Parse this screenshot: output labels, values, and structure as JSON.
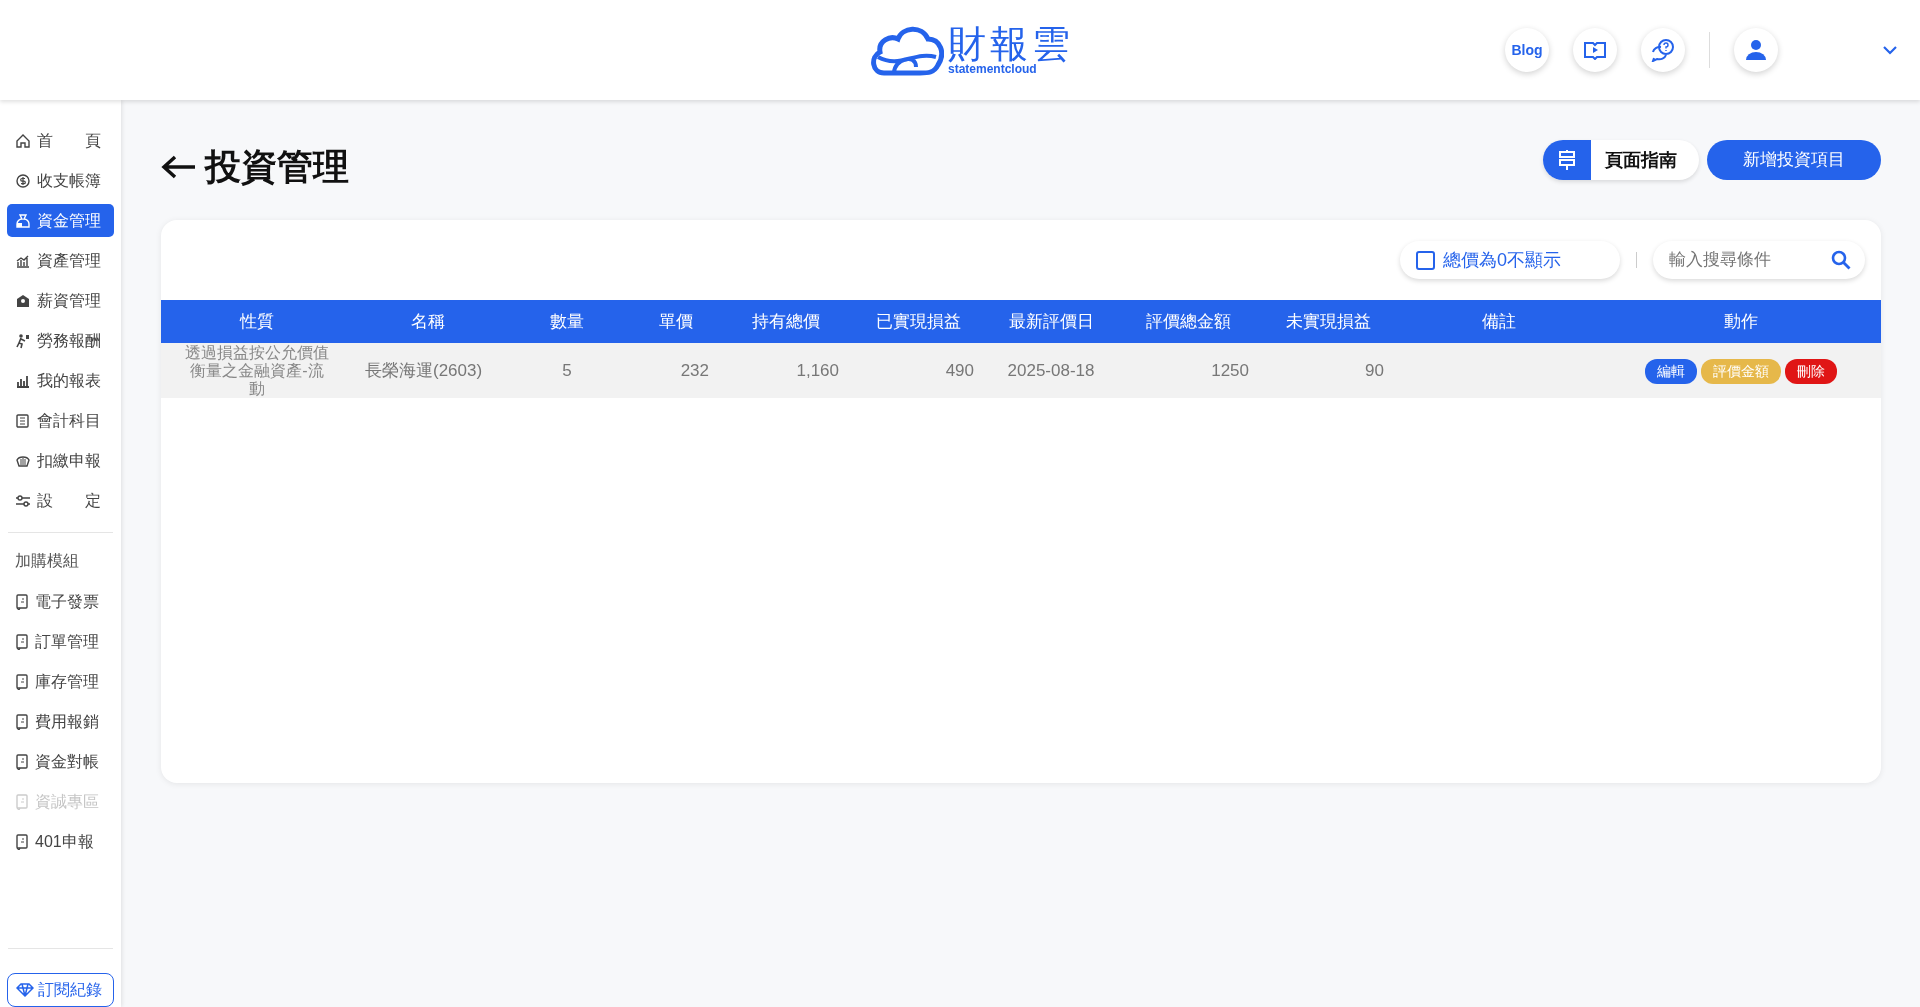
{
  "header": {
    "logo_text": "財報雲",
    "logo_subtext": "statementcloud",
    "blog_label": "Blog"
  },
  "sidebar": {
    "main_menu": [
      {
        "label": "首　　頁",
        "selected": false
      },
      {
        "label": "收支帳簿",
        "selected": false
      },
      {
        "label": "資金管理",
        "selected": true
      },
      {
        "label": "資產管理",
        "selected": false
      },
      {
        "label": "薪資管理",
        "selected": false
      },
      {
        "label": "勞務報酬",
        "selected": false
      },
      {
        "label": "我的報表",
        "selected": false
      },
      {
        "label": "會計科目",
        "selected": false
      },
      {
        "label": "扣繳申報",
        "selected": false
      },
      {
        "label": "設　　定",
        "selected": false
      }
    ],
    "addon_title": "加購模組",
    "addon_menu": [
      {
        "label": "電子發票",
        "disabled": false
      },
      {
        "label": "訂單管理",
        "disabled": false
      },
      {
        "label": "庫存管理",
        "disabled": false
      },
      {
        "label": "費用報銷",
        "disabled": false
      },
      {
        "label": "資金對帳",
        "disabled": false
      },
      {
        "label": "資誠專區",
        "disabled": true
      },
      {
        "label": "401申報",
        "disabled": false
      }
    ],
    "subscription_button": "訂閱紀錄"
  },
  "page": {
    "title": "投資管理",
    "guide_button": "頁面指南",
    "add_button": "新增投資項目"
  },
  "filter": {
    "hide_zero_label": "總價為0不顯示",
    "hide_zero_checked": false,
    "search_placeholder": "輸入搜尋條件"
  },
  "table": {
    "columns": [
      "性質",
      "名稱",
      "數量",
      "單價",
      "持有總價",
      "已實現損益",
      "最新評價日",
      "評價總金額",
      "未實現損益",
      "備註",
      "動作"
    ],
    "rows": [
      {
        "cells": [
          "透過損益按公允價值衡量之金融資產-流動",
          "長榮海運(2603)",
          "5",
          "232",
          "1,160",
          "490",
          "2025-08-18",
          "1250",
          "90",
          null
        ],
        "actions": [
          {
            "label": "編輯",
            "kind": "edit"
          },
          {
            "label": "評價金額",
            "kind": "value"
          },
          {
            "label": "刪除",
            "kind": "delete"
          }
        ]
      }
    ]
  }
}
